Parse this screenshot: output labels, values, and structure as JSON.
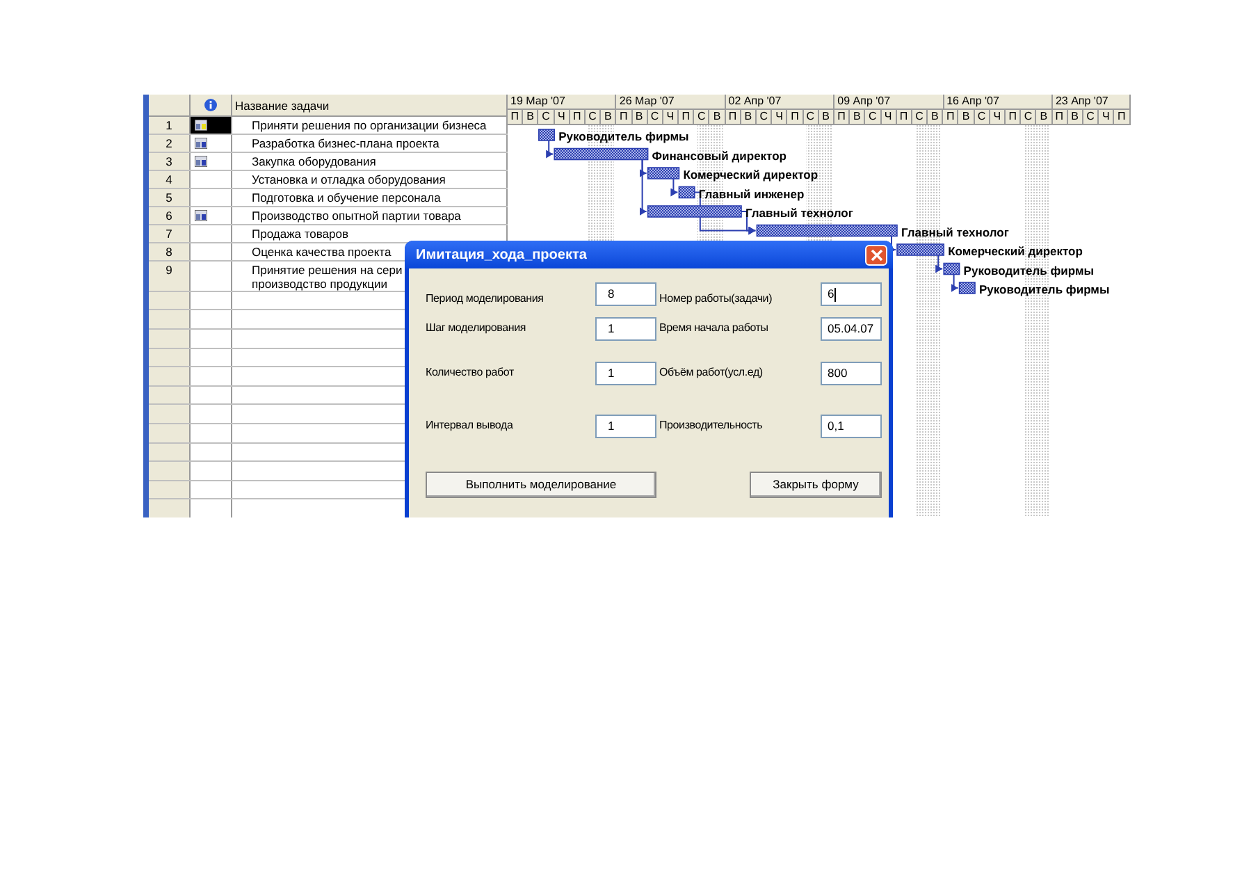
{
  "table": {
    "columns": {
      "name": "Название задачи"
    },
    "rows": [
      {
        "id": "1",
        "indicator": true,
        "selected": true,
        "name_lines": [
          "Приняти решения по организации бизнеса"
        ]
      },
      {
        "id": "2",
        "indicator": true,
        "selected": false,
        "name_lines": [
          "Разработка бизнес-плана проекта"
        ]
      },
      {
        "id": "3",
        "indicator": true,
        "selected": false,
        "name_lines": [
          "Закупка оборудования"
        ]
      },
      {
        "id": "4",
        "indicator": false,
        "selected": false,
        "name_lines": [
          "Установка и отладка оборудования"
        ]
      },
      {
        "id": "5",
        "indicator": false,
        "selected": false,
        "name_lines": [
          "Подготовка и обучение  персонала"
        ]
      },
      {
        "id": "6",
        "indicator": true,
        "selected": false,
        "name_lines": [
          "Производство опытной партии товара"
        ]
      },
      {
        "id": "7",
        "indicator": false,
        "selected": false,
        "name_lines": [
          "Продажа товаров"
        ]
      },
      {
        "id": "8",
        "indicator": false,
        "selected": false,
        "name_lines": [
          "Оценка качества проекта"
        ]
      },
      {
        "id": "9",
        "indicator": false,
        "selected": false,
        "name_lines": [
          "Принятие решения на сери",
          "производство продукции"
        ]
      }
    ]
  },
  "gantt": {
    "days": [
      [
        "П",
        "В",
        "С",
        "Ч",
        "П",
        "С",
        "В"
      ],
      [
        "П",
        "В",
        "С",
        "Ч",
        "П",
        "С",
        "В"
      ],
      [
        "П",
        "В",
        "С",
        "Ч",
        "П",
        "С",
        "В"
      ],
      [
        "П",
        "В",
        "С",
        "Ч",
        "П",
        "С",
        "В"
      ],
      [
        "П",
        "В",
        "С",
        "Ч",
        "П",
        "С",
        "В"
      ],
      [
        "П",
        "В",
        "С",
        "Ч",
        "П"
      ]
    ],
    "weeks": [
      "19 Мар '07",
      "26 Мар '07",
      "02 Апр '07",
      "09 Апр '07",
      "16 Апр '07",
      "23 Апр '07"
    ],
    "bar_labels": [
      "Руководитель фирмы",
      "Финансовый директор",
      "Комерческий директор",
      "Главный инженер",
      "Главный технолог",
      "Главный технолог",
      "Комерческий директор",
      "Руководитель фирмы",
      "Руководитель фирмы"
    ]
  },
  "dialog": {
    "title": "Имитация_хода_проекта",
    "fields": [
      {
        "label": "Период моделирования",
        "value": "8",
        "focused": false
      },
      {
        "label": "Номер работы(задачи)",
        "value": "6",
        "focused": true
      },
      {
        "label": "Шаг моделирования",
        "value": "1",
        "focused": false
      },
      {
        "label": "Время начала работы",
        "value": "05.04.07",
        "focused": false
      },
      {
        "label": "Количество работ",
        "value": "1",
        "focused": false
      },
      {
        "label": "Объём работ(усл.ед)",
        "value": "800",
        "focused": false
      },
      {
        "label": "Интервал вывода",
        "value": "1",
        "focused": false
      },
      {
        "label": "Производительность",
        "value": "0,1",
        "focused": false
      }
    ],
    "buttons": [
      "Выполнить моделирование",
      "Закрыть форму"
    ]
  }
}
